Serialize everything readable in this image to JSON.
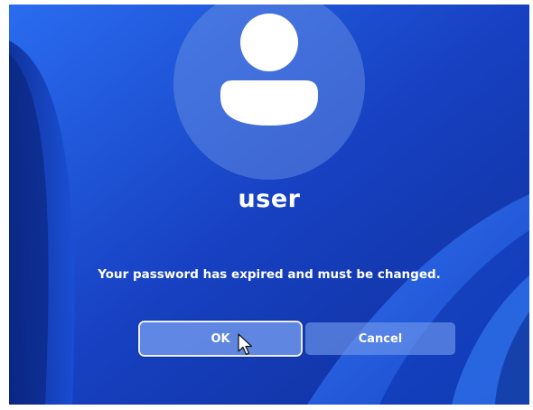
{
  "user": {
    "name": "user"
  },
  "dialog": {
    "message": "Your password has expired and must be changed.",
    "ok_label": "OK",
    "cancel_label": "Cancel"
  },
  "icons": {
    "avatar": "user-avatar-icon",
    "cursor": "mouse-pointer-icon"
  },
  "colors": {
    "background": "#1a44c8",
    "text": "#ffffff"
  }
}
